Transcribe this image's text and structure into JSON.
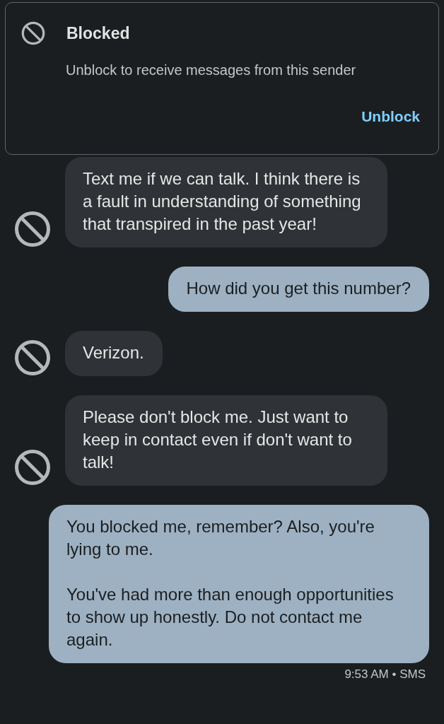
{
  "banner": {
    "title": "Blocked",
    "subtitle": "Unblock to receive messages from this sender",
    "action": "Unblock"
  },
  "messages": [
    {
      "kind": "incoming",
      "text": "Text me if we can talk. I think there is a fault in understanding of something that transpired in the past year!"
    },
    {
      "kind": "outgoing",
      "text": "How did you get this number?"
    },
    {
      "kind": "incoming",
      "text": "Verizon."
    },
    {
      "kind": "incoming",
      "text": "Please don't block me. Just want to keep in contact even if don't want to talk!"
    },
    {
      "kind": "outgoing",
      "text": "You blocked me, remember? Also, you're lying to me.\n\nYou've had more than enough opportunities to show up honestly. Do not contact me again."
    }
  ],
  "status": "9:53 AM • SMS"
}
